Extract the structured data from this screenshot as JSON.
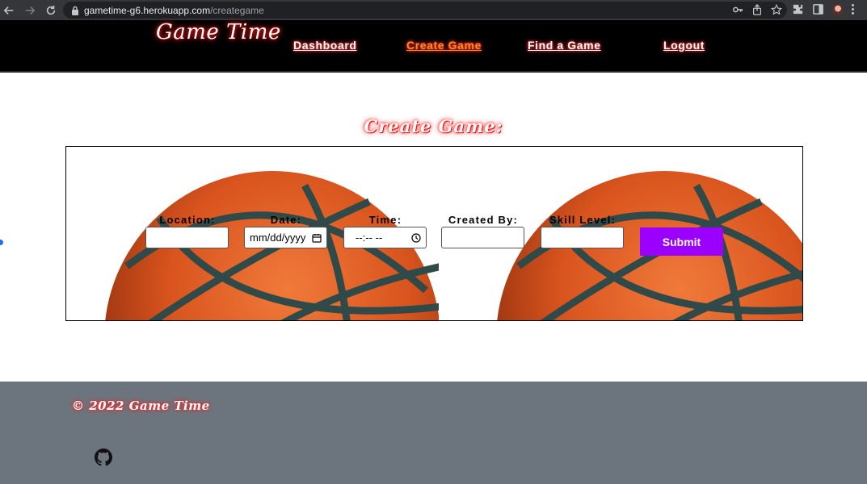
{
  "browser": {
    "url_host": "gametime-g6.herokuapp.com",
    "url_path": "/creategame"
  },
  "site": {
    "logo": "Game Time",
    "nav": [
      {
        "label": "Dashboard",
        "active": false
      },
      {
        "label": "Create Game",
        "active": true
      },
      {
        "label": "Find a Game",
        "active": false
      },
      {
        "label": "Logout",
        "active": false
      }
    ],
    "accent_active": "#ff8a1a",
    "header_bg": "#000000"
  },
  "main": {
    "title": "Create Game:",
    "form": {
      "location": {
        "label": "Location:",
        "value": ""
      },
      "date": {
        "label": "Date:",
        "value": "mm/dd/yyyy"
      },
      "time": {
        "label": "Time:",
        "value": "--:-- --"
      },
      "created_by": {
        "label": "Created By:",
        "value": ""
      },
      "skill_level": {
        "label": "Skill Level:",
        "value": ""
      },
      "submit_label": "Submit",
      "submit_color": "#9b00ff"
    }
  },
  "footer": {
    "copyright": "© 2022 Game Time",
    "bg": "#6c757d",
    "icon": "github-icon"
  }
}
